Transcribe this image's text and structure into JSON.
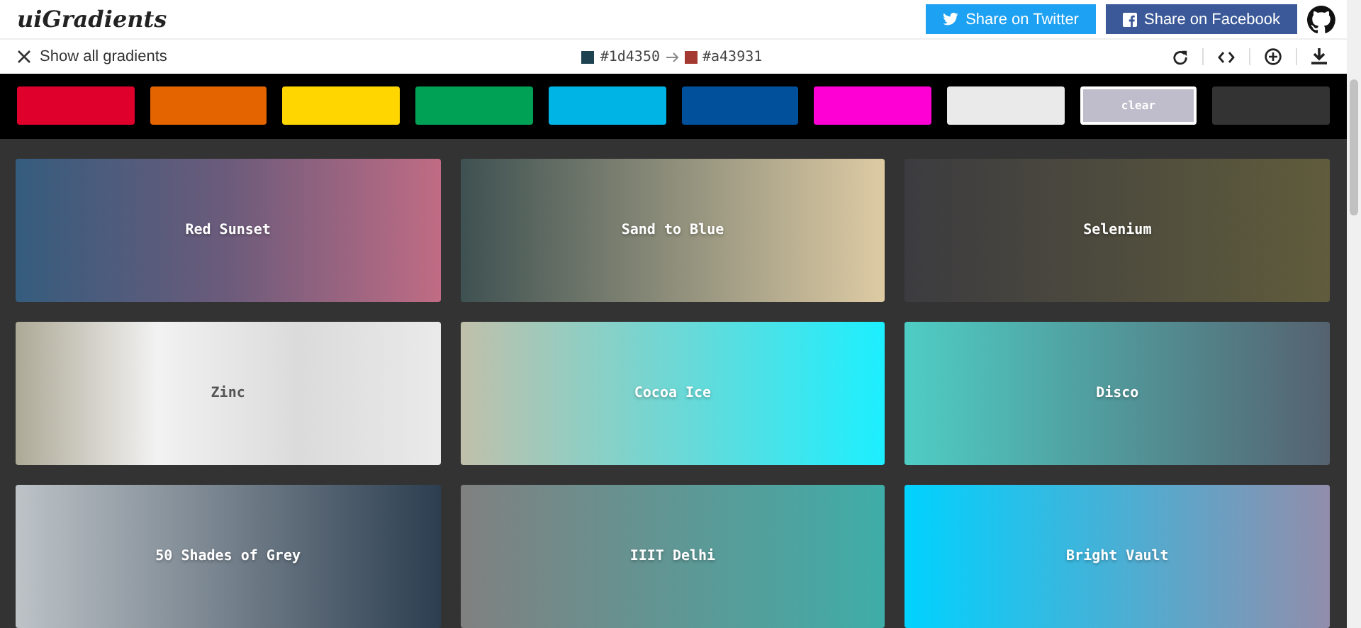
{
  "header": {
    "logo": "uiGradients",
    "buttons": [
      {
        "kind": "twitter",
        "label": "Share on Twitter"
      },
      {
        "kind": "facebook",
        "label": "Share on Facebook"
      }
    ]
  },
  "toolbar": {
    "back": "Show all gradients",
    "from": {
      "color": "#1d4350",
      "label": "#1d4350"
    },
    "to": {
      "color": "#a43931",
      "label": "#a43931"
    }
  },
  "filters": [
    {
      "color": "#e0002c",
      "selected": false
    },
    {
      "color": "#e46500",
      "selected": false
    },
    {
      "color": "#ffd600",
      "selected": false
    },
    {
      "color": "#00a055",
      "selected": false
    },
    {
      "color": "#00b4e6",
      "selected": false
    },
    {
      "color": "#00509c",
      "selected": false
    },
    {
      "color": "#ff00d4",
      "selected": false
    },
    {
      "color": "#eaeaea",
      "selected": false
    },
    {
      "color": "#bfbdcb",
      "label": "clear",
      "selected": true
    },
    {
      "color": "#333333",
      "selected": false
    }
  ],
  "gradients": [
    {
      "name": "Red Sunset",
      "colors": [
        {
          "color": "#355c7d"
        },
        {
          "color": "#6c5b7b"
        },
        {
          "color": "#c06c84"
        }
      ]
    },
    {
      "name": "Sand to Blue",
      "colors": [
        {
          "color": "#3e5151"
        },
        {
          "color": "#decba4"
        }
      ]
    },
    {
      "name": "Selenium",
      "colors": [
        {
          "color": "#3c3b3f"
        },
        {
          "color": "#605c3c"
        }
      ]
    },
    {
      "name": "Zinc",
      "colors": [
        {
          "color": "#ada996"
        },
        {
          "color": "#f2f2f2"
        },
        {
          "color": "#dbdbdb"
        },
        {
          "color": "#eaeaea"
        }
      ]
    },
    {
      "name": "Cocoa Ice",
      "colors": [
        {
          "color": "#c0c0aa"
        },
        {
          "color": "#1cefff"
        }
      ]
    },
    {
      "name": "Disco",
      "colors": [
        {
          "color": "#4ecdc4"
        },
        {
          "color": "#556270"
        }
      ]
    },
    {
      "name": "50 Shades of Grey",
      "colors": [
        {
          "color": "#bdc3c7"
        },
        {
          "color": "#2c3e50"
        }
      ]
    },
    {
      "name": "IIIT Delhi",
      "colors": [
        {
          "color": "#808080"
        },
        {
          "color": "#3fada8"
        }
      ]
    },
    {
      "name": "Bright Vault",
      "colors": [
        {
          "color": "#00d2ff"
        },
        {
          "color": "#928dab"
        }
      ]
    }
  ]
}
